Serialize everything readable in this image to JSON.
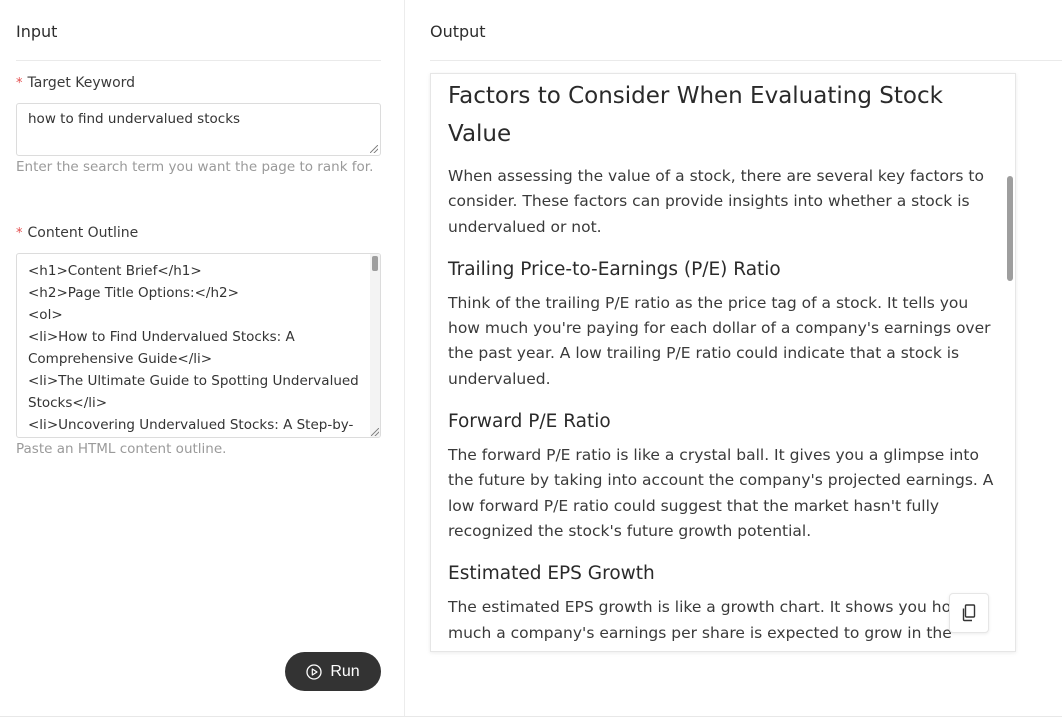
{
  "input": {
    "heading": "Input",
    "keyword": {
      "required_mark": "*",
      "label": "Target Keyword",
      "value": "how to find undervalued stocks",
      "help": "Enter the search term you want the page to rank for."
    },
    "outline": {
      "required_mark": "*",
      "label": "Content Outline",
      "value": "<h1>Content Brief</h1>\n<h2>Page Title Options:</h2>\n<ol>\n<li>How to Find Undervalued Stocks: A Comprehensive Guide</li>\n<li>The Ultimate Guide to Spotting Undervalued Stocks</li>\n<li>Uncovering Undervalued Stocks: A Step-by-",
      "help": "Paste an HTML content outline."
    },
    "run_label": "Run"
  },
  "output": {
    "heading": "Output",
    "article": {
      "title": "Factors to Consider When Evaluating Stock Value",
      "intro": "When assessing the value of a stock, there are several key factors to consider. These factors can provide insights into whether a stock is undervalued or not.",
      "sections": [
        {
          "heading": "Trailing Price-to-Earnings (P/E) Ratio",
          "body": "Think of the trailing P/E ratio as the price tag of a stock. It tells you how much you're paying for each dollar of a company's earnings over the past year. A low trailing P/E ratio could indicate that a stock is undervalued."
        },
        {
          "heading": "Forward P/E Ratio",
          "body": "The forward P/E ratio is like a crystal ball. It gives you a glimpse into the future by taking into account the company's projected earnings. A low forward P/E ratio could suggest that the market hasn't fully recognized the stock's future growth potential."
        },
        {
          "heading": "Estimated EPS Growth",
          "body": "The estimated EPS growth is like a growth chart. It shows you how much a company's earnings per share is expected to grow in the future."
        }
      ]
    }
  },
  "icons": {
    "run": "play-circle-icon",
    "copy": "copy-icon"
  },
  "colors": {
    "required": "#e34d4d",
    "run_button": "#333333"
  }
}
